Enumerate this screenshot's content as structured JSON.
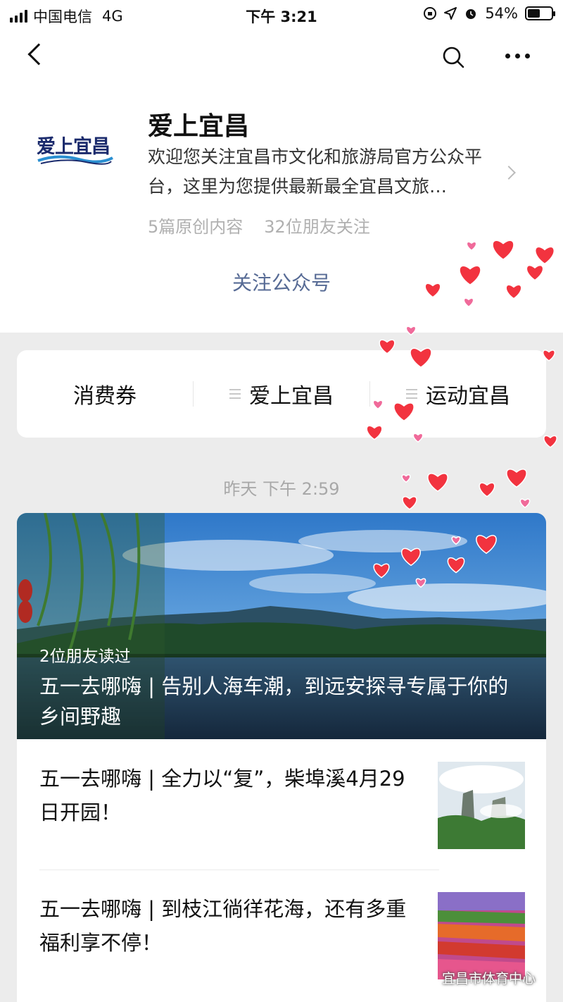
{
  "status_bar": {
    "carrier": "中国电信",
    "network": "4G",
    "time": "下午 3:21",
    "battery": "54%",
    "battery_level": 0.54
  },
  "account": {
    "logo_text": "爱上宜昌",
    "name": "爱上宜昌",
    "description": "欢迎您关注宜昌市文化和旅游局官方公众平台，这里为您提供最新最全宜昌文旅…",
    "original_count": "5篇原创内容",
    "friends_following": "32位朋友关注",
    "follow_label": "关注公众号"
  },
  "menu": {
    "items": [
      {
        "label": "消费券"
      },
      {
        "label": "爱上宜昌"
      },
      {
        "label": "运动宜昌"
      }
    ]
  },
  "feed": {
    "timestamp": "昨天 下午 2:59",
    "cover": {
      "friends_read": "2位朋友读过",
      "title": "五一去哪嗨 | 告别人海车潮，到远安探寻专属于你的乡间野趣"
    },
    "articles": [
      {
        "title": "五一去哪嗨 | 全力以“复”，柴埠溪4月29日开园！"
      },
      {
        "title": "五一去哪嗨 | 到枝江徜徉花海，还有多重福利享不停！"
      }
    ]
  },
  "watermark": "宜昌市体育中心",
  "colors": {
    "link": "#576b95",
    "heart": "#f2333f",
    "background": "#ececec"
  }
}
